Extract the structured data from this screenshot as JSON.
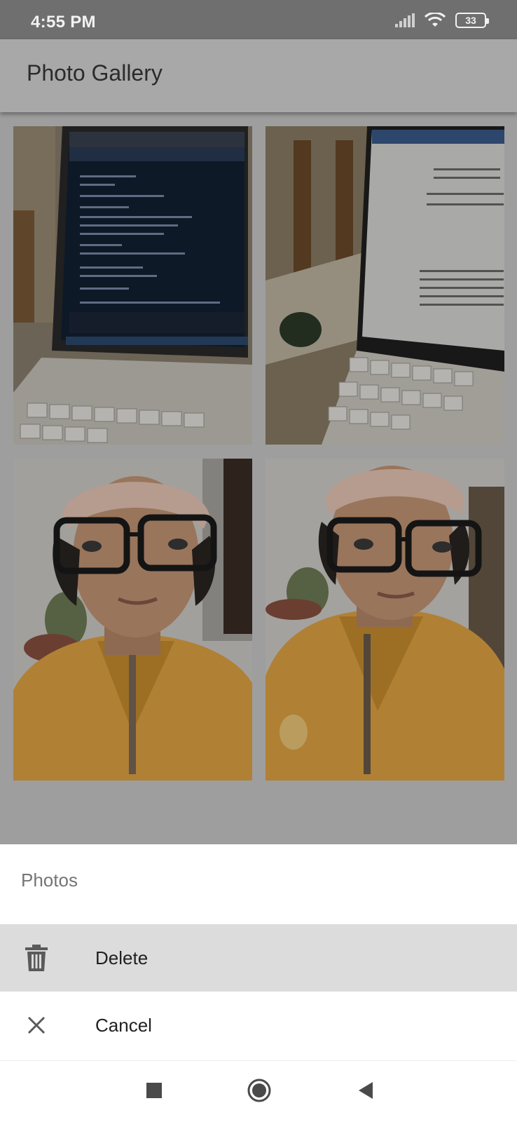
{
  "status_bar": {
    "time": "4:55 PM",
    "battery": "33"
  },
  "app_bar": {
    "title": "Photo Gallery"
  },
  "gallery": {
    "photos": [
      {
        "subject": "laptop-code-screen"
      },
      {
        "subject": "laptop-document-screen"
      },
      {
        "subject": "selfie-cap-glasses"
      },
      {
        "subject": "selfie-cap-glasses"
      }
    ]
  },
  "sheet": {
    "title": "Photos",
    "items": [
      {
        "label": "Delete",
        "icon": "trash-icon"
      },
      {
        "label": "Cancel",
        "icon": "close-icon"
      }
    ]
  },
  "nav": {
    "icons": [
      "recent-apps-icon",
      "home-icon",
      "back-icon"
    ]
  },
  "colors": {
    "status_bar": "#6f6f6f",
    "app_bar": "#a8a8a8",
    "scrim": "#9e9e9e",
    "selected_row": "#dcdcdc",
    "jacket": "#e2a545"
  }
}
